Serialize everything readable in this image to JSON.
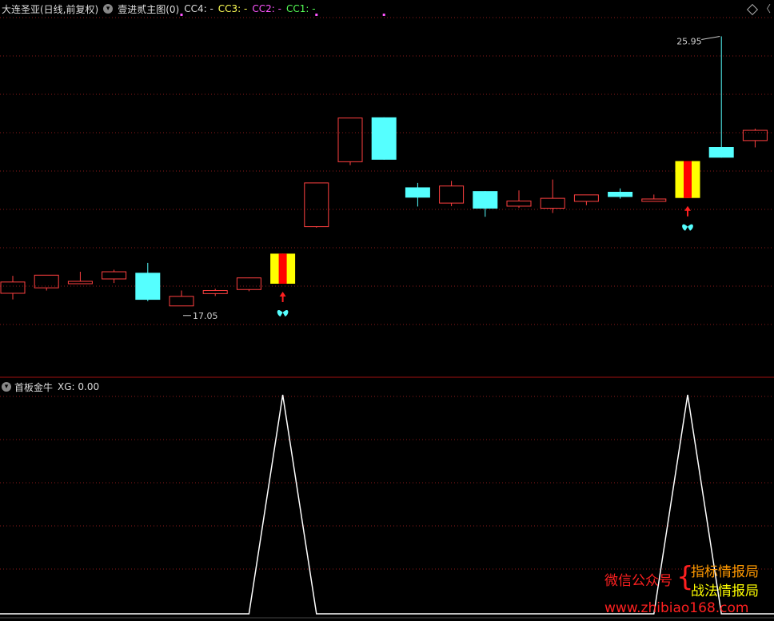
{
  "header": {
    "title": "大连圣亚(日线,前复权)",
    "indicator": "壹进贰主图(0)",
    "cc4": "CC4: -",
    "cc3": "CC3: -",
    "cc2": "CC2: -",
    "cc1": "CC1: -"
  },
  "sub_header": {
    "title": "首板金牛",
    "xg": "XG: 0.00"
  },
  "colors": {
    "up": "#ff4040",
    "down": "#55ffff",
    "signal_outer": "#ffff00",
    "signal_inner": "#ff0000",
    "grid": "#8b1a1a",
    "cc4": "#dddddd",
    "cc3": "#ffff55",
    "cc2": "#ff55ff",
    "cc1": "#55ff55",
    "line": "#ffffff"
  },
  "chart_data": {
    "type": "candlestick",
    "ylim": [
      16.3,
      26.5
    ],
    "max_label": "25.95",
    "min_label": "17.05",
    "candles": [
      {
        "o": 18.43,
        "c": 18.76,
        "h": 18.94,
        "l": 18.25
      },
      {
        "o": 18.59,
        "c": 18.96,
        "h": 18.96,
        "l": 18.51
      },
      {
        "o": 18.71,
        "c": 18.78,
        "h": 19.06,
        "l": 18.7
      },
      {
        "o": 18.85,
        "c": 19.06,
        "h": 19.12,
        "l": 18.73
      },
      {
        "o": 19.03,
        "c": 18.24,
        "h": 19.32,
        "l": 18.2
      },
      {
        "o": 18.06,
        "c": 18.34,
        "h": 18.51,
        "l": 18.06,
        "low_label": "17.05"
      },
      {
        "o": 18.42,
        "c": 18.51,
        "h": 18.56,
        "l": 18.35
      },
      {
        "o": 18.54,
        "c": 18.88,
        "h": 18.89,
        "l": 18.49
      },
      {
        "o": 18.71,
        "c": 19.59,
        "h": 19.59,
        "l": 18.71,
        "signal": true
      },
      {
        "o": 20.38,
        "c": 21.66,
        "h": 21.66,
        "l": 20.35
      },
      {
        "o": 22.28,
        "c": 23.56,
        "h": 23.56,
        "l": 22.18
      },
      {
        "o": 23.58,
        "c": 22.34,
        "h": 23.58,
        "l": 22.34
      },
      {
        "o": 21.53,
        "c": 21.23,
        "h": 21.66,
        "l": 20.97
      },
      {
        "o": 21.07,
        "c": 21.57,
        "h": 21.72,
        "l": 20.98
      },
      {
        "o": 21.42,
        "c": 20.91,
        "h": 21.42,
        "l": 20.67
      },
      {
        "o": 20.98,
        "c": 21.13,
        "h": 21.44,
        "l": 20.93
      },
      {
        "o": 20.92,
        "c": 21.21,
        "h": 21.76,
        "l": 20.78
      },
      {
        "o": 21.12,
        "c": 21.31,
        "h": 21.31,
        "l": 21.01
      },
      {
        "o": 21.4,
        "c": 21.25,
        "h": 21.5,
        "l": 21.2
      },
      {
        "o": 21.12,
        "c": 21.19,
        "h": 21.32,
        "l": 21.12
      },
      {
        "o": 21.22,
        "c": 22.3,
        "h": 22.3,
        "l": 21.22,
        "signal": true
      },
      {
        "o": 22.71,
        "c": 22.4,
        "h": 25.95,
        "l": 22.4,
        "high_label": "25.95"
      },
      {
        "o": 22.9,
        "c": 23.2,
        "h": 23.25,
        "l": 22.7
      }
    ],
    "xg": [
      0,
      0,
      0,
      0,
      0,
      0,
      0,
      0,
      1,
      0,
      0,
      0,
      0,
      0,
      0,
      0,
      0,
      0,
      0,
      0,
      1,
      0,
      0
    ],
    "top_markers": [
      5,
      9,
      11
    ]
  },
  "watermark": {
    "left": "微信公众号",
    "brace": "{",
    "line1": "指标情报局",
    "line2": "战法情报局",
    "url": "www.zhibiao168.com"
  }
}
